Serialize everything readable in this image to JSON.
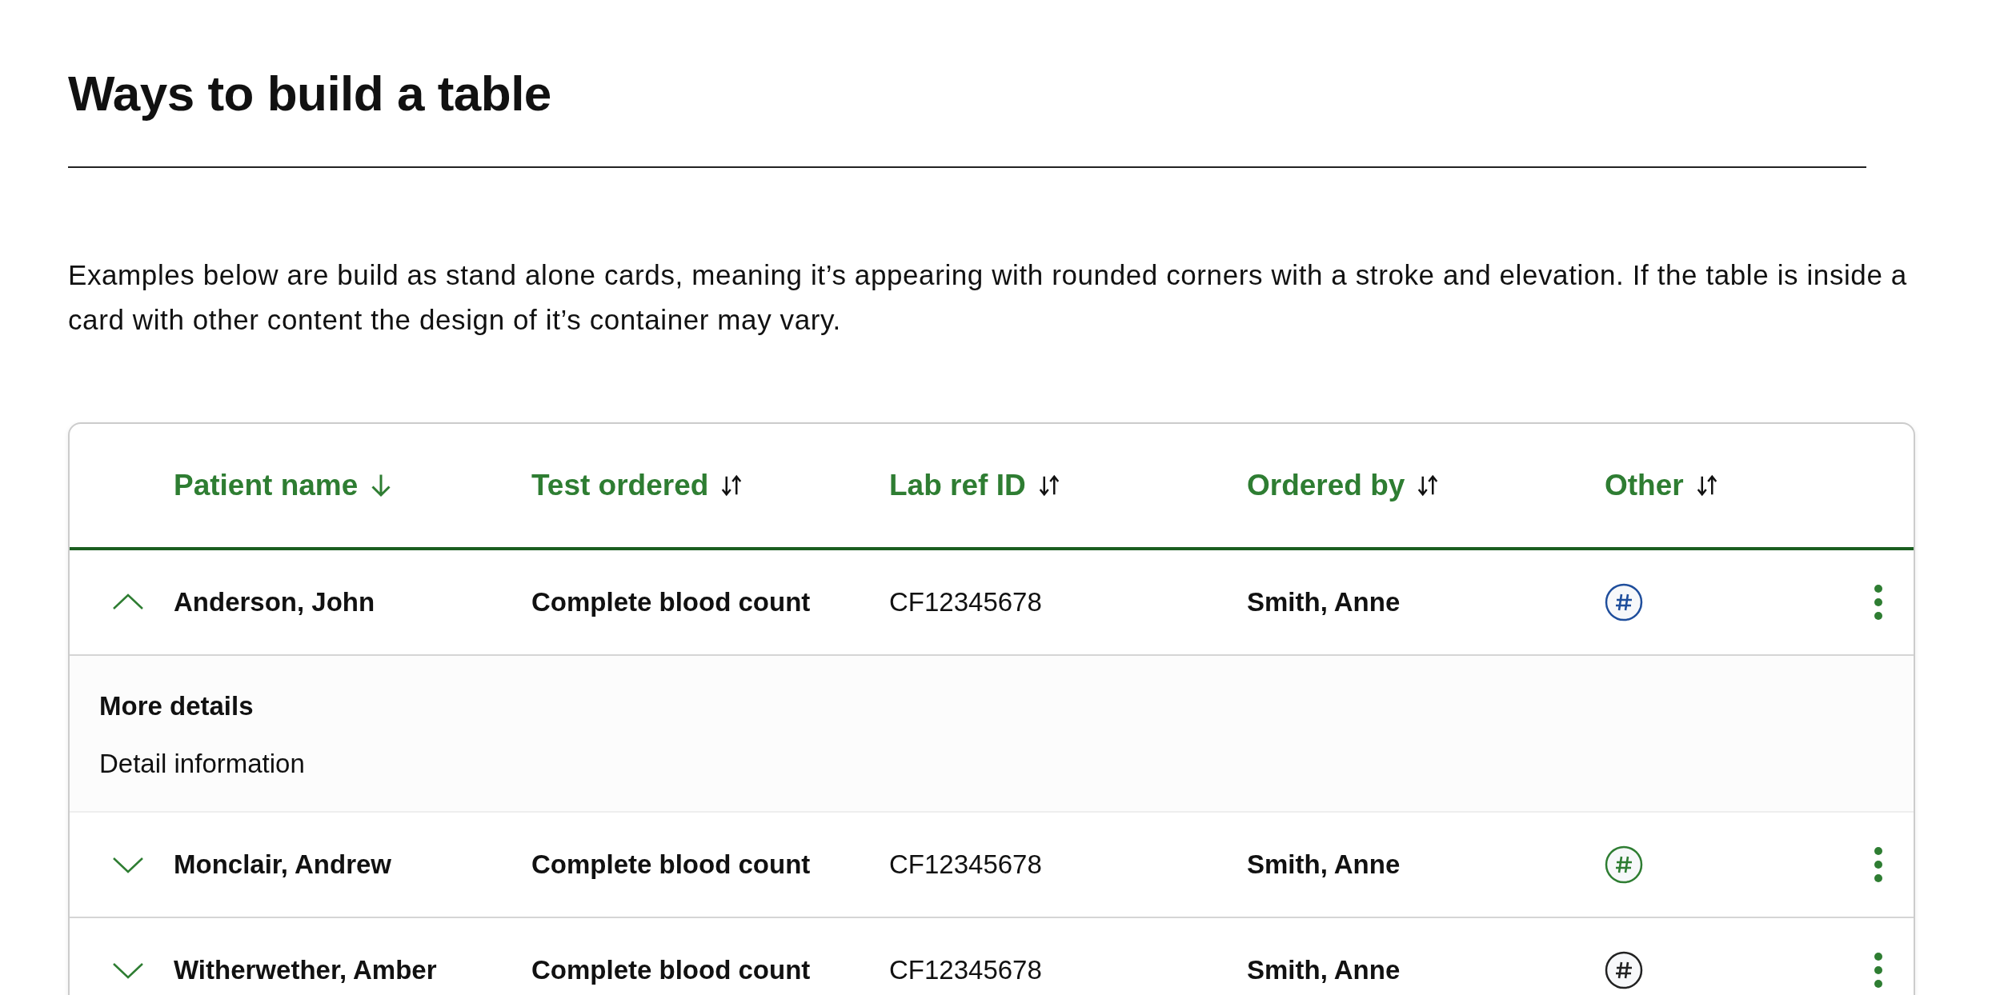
{
  "title": "Ways to build a table",
  "intro": "Examples below are build as stand alone cards, meaning it’s appearing with rounded corners with a stroke and elevation. If the table is inside a card with other content the design of it’s container may vary.",
  "table": {
    "columns": [
      {
        "label": "Patient name",
        "sorted": true
      },
      {
        "label": "Test ordered",
        "sorted": false
      },
      {
        "label": "Lab ref ID",
        "sorted": false
      },
      {
        "label": "Ordered by",
        "sorted": false
      },
      {
        "label": "Other",
        "sorted": false
      }
    ],
    "rows": [
      {
        "expanded": true,
        "patient": "Anderson, John",
        "test": "Complete blood count",
        "lab_ref": "CF12345678",
        "ordered_by": "Smith, Anne",
        "color": "#1f4e9c",
        "details": {
          "title": "More details",
          "text": "Detail information"
        }
      },
      {
        "expanded": false,
        "patient": "Monclair, Andrew",
        "test": "Complete blood count",
        "lab_ref": "CF12345678",
        "ordered_by": "Smith, Anne",
        "color": "#2e7d32"
      },
      {
        "expanded": false,
        "patient": "Witherwether, Amber",
        "test": "Complete blood count",
        "lab_ref": "CF12345678",
        "ordered_by": "Smith, Anne",
        "color": "#222222"
      }
    ]
  }
}
